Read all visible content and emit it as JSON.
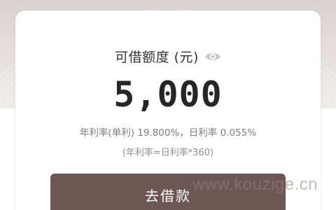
{
  "card": {
    "title": "可借额度 (元)",
    "amount": "5,000",
    "rate_line": "年利率(单利) 19.800%，日利率 0.055%",
    "formula": "(年利率=日利率*360)"
  },
  "actions": {
    "borrow_label": "去借款"
  },
  "watermark": {
    "text": "www.kouzige.cn"
  },
  "icons": {
    "visibility": "eye-icon"
  },
  "colors": {
    "button_bg": "#6e5655",
    "amount_text": "#262626",
    "secondary_text": "#7c7c7c"
  }
}
